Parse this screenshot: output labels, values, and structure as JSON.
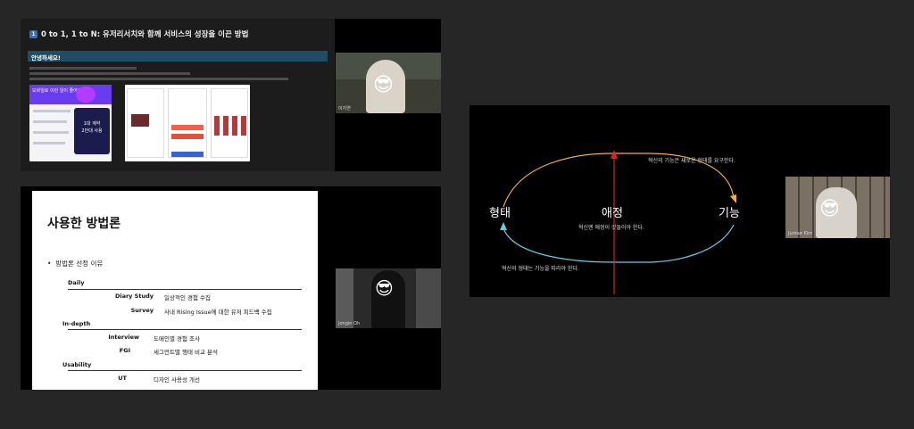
{
  "tile_notion": {
    "title_num": "1",
    "title": "0 to 1, 1 to N: 유저리서치와 함께 서비스의 성장을 이끈 방법",
    "banner": "안녕하세요!",
    "promo_text": "모바일로 이런 일이 줄어요",
    "promo_badge_1": "1대 계약",
    "promo_badge_2": "2만대 사용",
    "camera_name": "이지연"
  },
  "tile_slide": {
    "heading": "사용한 방법론",
    "bullet": "방법론 선정 이유",
    "sections": [
      {
        "label": "Daily"
      },
      {
        "label": "In-depth"
      },
      {
        "label": "Usability"
      }
    ],
    "rows": [
      {
        "method": "Diary Study",
        "desc": "일상적인 경험 수집"
      },
      {
        "method": "Survey",
        "desc": "사내 Rising Issue에 대한 유저 피드백 수집"
      },
      {
        "method": "Interview",
        "desc": "도메인별 경험 조사"
      },
      {
        "method": "FGI",
        "desc": "세그먼트별 행태 비교 분석"
      },
      {
        "method": "UT",
        "desc": "디자인 사용성 개선"
      }
    ],
    "camera_name": "Jongin Oh"
  },
  "tile_diagram": {
    "left_word": "형태",
    "center_word": "애정",
    "right_word": "기능",
    "top_caption": "혁신의 기능은 새로운 형태를 요구한다.",
    "center_caption": "혁신엔 애정이 깃들어야 한다.",
    "bottom_caption": "혁신의 형태는 기능을 따라야 한다.",
    "camera_name": "Juntae Kim",
    "colors": {
      "top_arc": "#f0b13a",
      "bottom_arc": "#5ed0e8",
      "arrow": "#e0231f"
    }
  },
  "avatar_emoji": "😎"
}
